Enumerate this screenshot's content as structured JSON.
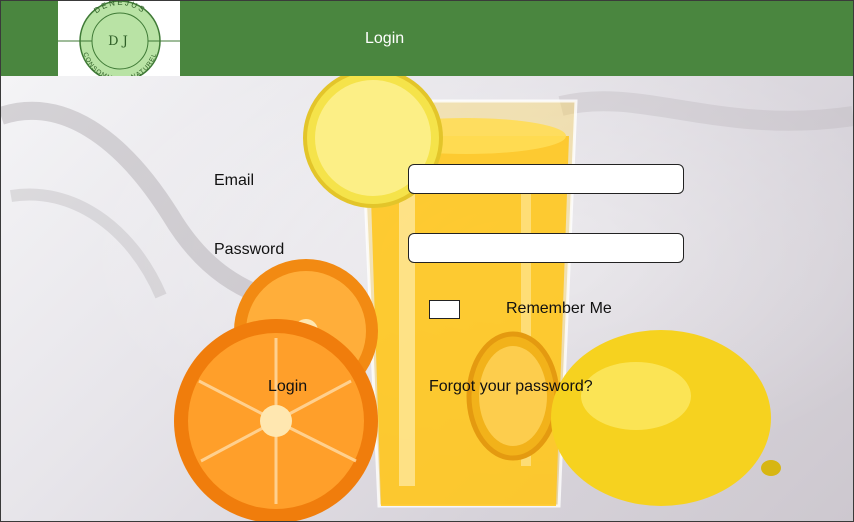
{
  "header": {
    "title": "Login",
    "background": "#4a863f",
    "logo": {
      "initials": "DJ",
      "ring_top": "DENEJUS",
      "ring_bottom": "CONSOMMONS NATUREL",
      "fill": "#b9e3a5",
      "icon": "brand-logo"
    }
  },
  "form": {
    "email_label": "Email",
    "email_value": "",
    "password_label": "Password",
    "password_value": "",
    "remember_label": "Remember Me",
    "remember_checked": false,
    "login_label": "Login",
    "forgot_label": "Forgot your password?"
  },
  "background_image": {
    "subject": "glass of orange juice with oranges and a lemon",
    "colors": {
      "juice": "#ffc61a",
      "orange": "#f28a12",
      "lemon": "#f6d21f"
    }
  }
}
